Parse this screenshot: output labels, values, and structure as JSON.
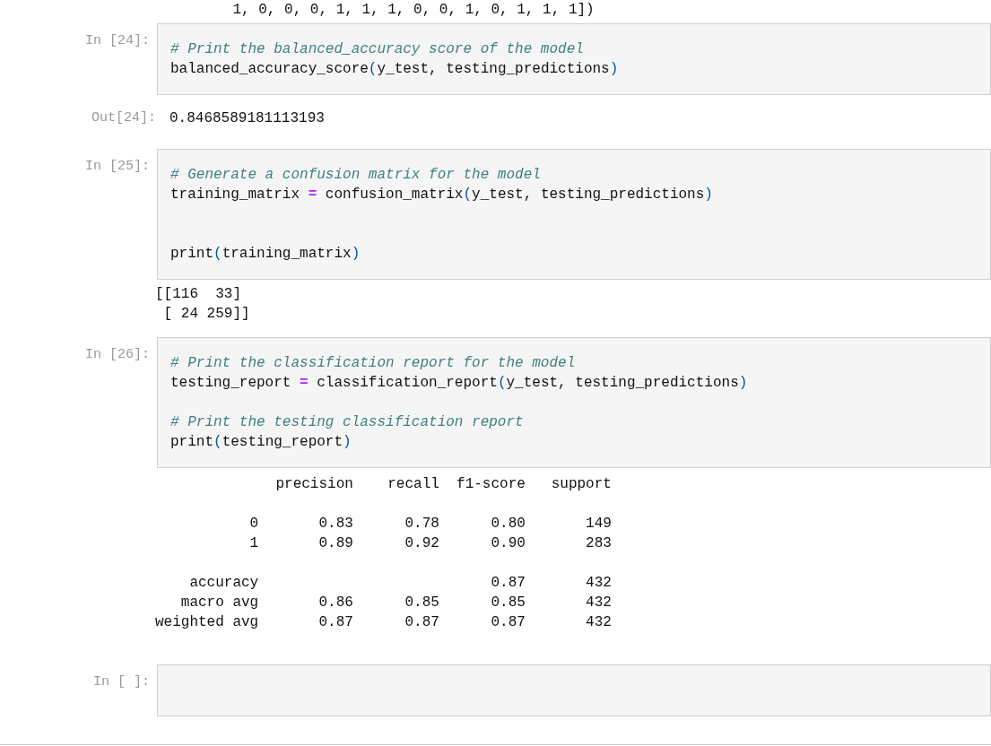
{
  "cells": [
    {
      "kind": "stream",
      "text": "         1, 0, 0, 0, 1, 1, 1, 0, 0, 1, 0, 1, 1, 1])"
    },
    {
      "kind": "input",
      "prompt": "In [24]:",
      "code": [
        {
          "kind": "comment",
          "text": "# Print the balanced_accuracy score of the model"
        },
        {
          "kind": "plain",
          "text": "\nbalanced_accuracy_score"
        },
        {
          "kind": "paren",
          "text": "("
        },
        {
          "kind": "plain",
          "text": "y_test, testing_predictions"
        },
        {
          "kind": "paren",
          "text": ")"
        }
      ]
    },
    {
      "kind": "result",
      "prompt": "Out[24]:",
      "text": "0.8468589181113193"
    },
    {
      "kind": "input",
      "prompt": "In [25]:",
      "code": [
        {
          "kind": "comment",
          "text": "# Generate a confusion matrix for the model"
        },
        {
          "kind": "plain",
          "text": "\ntraining_matrix "
        },
        {
          "kind": "operator",
          "text": "="
        },
        {
          "kind": "plain",
          "text": " confusion_matrix"
        },
        {
          "kind": "paren",
          "text": "("
        },
        {
          "kind": "plain",
          "text": "y_test, testing_predictions"
        },
        {
          "kind": "paren",
          "text": ")"
        },
        {
          "kind": "plain",
          "text": "\n\n\nprint"
        },
        {
          "kind": "paren",
          "text": "("
        },
        {
          "kind": "plain",
          "text": "training_matrix"
        },
        {
          "kind": "paren",
          "text": ")"
        }
      ]
    },
    {
      "kind": "stream",
      "text": "[[116  33]\n [ 24 259]]"
    },
    {
      "kind": "input",
      "prompt": "In [26]:",
      "code": [
        {
          "kind": "comment",
          "text": "# Print the classification report for the model"
        },
        {
          "kind": "plain",
          "text": "\ntesting_report "
        },
        {
          "kind": "operator",
          "text": "="
        },
        {
          "kind": "plain",
          "text": " classification_report"
        },
        {
          "kind": "paren",
          "text": "("
        },
        {
          "kind": "plain",
          "text": "y_test, testing_predictions"
        },
        {
          "kind": "paren",
          "text": ")"
        },
        {
          "kind": "comment",
          "text": "\n\n# Print the testing classification report"
        },
        {
          "kind": "plain",
          "text": "\nprint"
        },
        {
          "kind": "paren",
          "text": "("
        },
        {
          "kind": "plain",
          "text": "testing_report"
        },
        {
          "kind": "paren",
          "text": ")"
        }
      ]
    },
    {
      "kind": "stream",
      "text": "              precision    recall  f1-score   support\n\n           0       0.83      0.78      0.80       149\n           1       0.89      0.92      0.90       283\n\n    accuracy                           0.87       432\n   macro avg       0.86      0.85      0.85       432\nweighted avg       0.87      0.87      0.87       432"
    },
    {
      "kind": "input",
      "prompt": "In [ ]:"
    }
  ]
}
